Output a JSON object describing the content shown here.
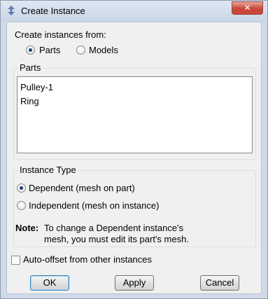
{
  "window": {
    "title": "Create Instance",
    "close_glyph": "✕"
  },
  "source": {
    "label": "Create instances from:",
    "options": [
      {
        "label": "Parts",
        "checked": true
      },
      {
        "label": "Models",
        "checked": false
      }
    ]
  },
  "parts": {
    "group_label": "Parts",
    "items": [
      "Pulley-1",
      "Ring"
    ]
  },
  "instance_type": {
    "group_label": "Instance Type",
    "options": [
      {
        "label": "Dependent (mesh on part)",
        "checked": true
      },
      {
        "label": "Independent (mesh on instance)",
        "checked": false
      }
    ],
    "note_label": "Note:",
    "note_line1": "To change a Dependent instance's",
    "note_line2": "mesh, you must edit its part's mesh."
  },
  "auto_offset": {
    "label": "Auto-offset from other instances",
    "checked": false
  },
  "buttons": {
    "ok": "OK",
    "apply": "Apply",
    "cancel": "Cancel"
  },
  "icons": {
    "app": "arrows-icon",
    "close": "close-icon"
  }
}
